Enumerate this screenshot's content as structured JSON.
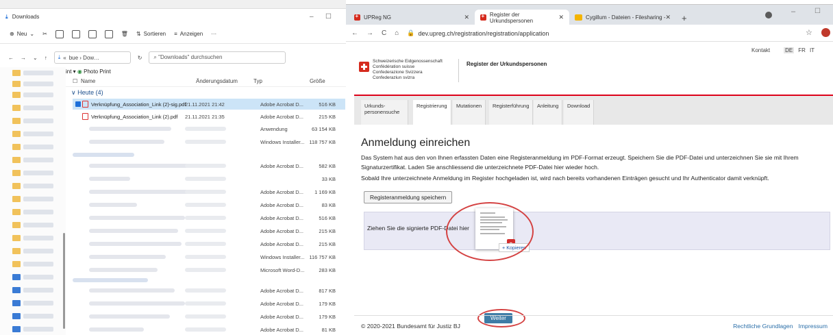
{
  "explorer": {
    "window_title": "Downloads",
    "command_bar": {
      "new_label": "Neu",
      "sort_label": "Sortieren",
      "view_label": "Anzeigen",
      "more_label": "···"
    },
    "nav": {
      "address_prefix": "«",
      "address": "bue › Dow…",
      "search_placeholder": "\"Downloads\" durchsuchen"
    },
    "crumb_fragment_prefix": "int ▾",
    "crumb_fragment": "Photo Print",
    "columns": {
      "name": "Name",
      "date": "Änderungsdatum",
      "type": "Typ",
      "size": "Größe"
    },
    "group_today": "∨ Heute (4)",
    "files": [
      {
        "name": "Verknüpfung_Association_Link (2)-sig.pdf",
        "date": "21.11.2021 21:42",
        "type": "Adobe Acrobat D...",
        "size": "516 KB"
      },
      {
        "name": "Verknüpfung_Association_Link (2).pdf",
        "date": "21.11.2021 21:35",
        "type": "Adobe Acrobat D...",
        "size": "215 KB"
      }
    ],
    "other_rows": [
      {
        "type": "Anwendung",
        "size": "63 154 KB"
      },
      {
        "type": "Windows Installer...",
        "size": "118 757 KB"
      },
      {
        "type": "Adobe Acrobat D...",
        "size": "582 KB"
      },
      {
        "type": "",
        "size": "33 KB"
      },
      {
        "type": "Adobe Acrobat D...",
        "size": "1 169 KB"
      },
      {
        "type": "Adobe Acrobat D...",
        "size": "83 KB"
      },
      {
        "type": "Adobe Acrobat D...",
        "size": "516 KB"
      },
      {
        "type": "Adobe Acrobat D...",
        "size": "215 KB"
      },
      {
        "type": "Adobe Acrobat D...",
        "size": "215 KB"
      },
      {
        "type": "Windows Installer...",
        "size": "116 757 KB"
      },
      {
        "type": "Microsoft Word-D...",
        "size": "283 KB"
      },
      {
        "type": "Adobe Acrobat D...",
        "size": "817 KB"
      },
      {
        "type": "Adobe Acrobat D...",
        "size": "179 KB"
      },
      {
        "type": "Adobe Acrobat D...",
        "size": "179 KB"
      },
      {
        "type": "Adobe Acrobat D...",
        "size": "81 KB"
      }
    ]
  },
  "browser": {
    "tabs": [
      {
        "label": "UPReg NG"
      },
      {
        "label": "Register der Urkundspersonen"
      },
      {
        "label": "Cygillum - Dateien - Filesharing -"
      }
    ],
    "new_tab": "+",
    "url": "dev.upreg.ch/registration/registration/application"
  },
  "site": {
    "agency_lines": [
      "Schweizerische Eidgenossenschaft",
      "Confédération suisse",
      "Confederazione Svizzera",
      "Confederaziun svizra"
    ],
    "title": "Register der Urkundspersonen",
    "contact": "Kontakt",
    "languages": [
      "DE",
      "FR",
      "IT"
    ],
    "nav_tabs": [
      "Urkunds-\npersonensuche",
      "Registrierung",
      "Mutationen",
      "Registerführung",
      "Anleitung",
      "Download"
    ],
    "page_title": "Anmeldung einreichen",
    "para1": "Das System hat aus den von Ihnen erfassten Daten eine Registeranmeldung im PDF-Format erzeugt. Speichern Sie die PDF-Datei und unterzeichnen Sie sie mit Ihrem Signaturzertifikat. Laden Sie anschliessend die unterzeichnete PDF-Datei hier wieder hoch.",
    "para2": "Sobald Ihre unterzeichnete Anmeldung im Register hochgeladen ist, wird nach bereits vorhandenen Einträgen gesucht und Ihr Authenticator damit verknüpft.",
    "save_button": "Registeranmeldung speichern",
    "dropzone_text": "Ziehen Sie die signierte PDF-Datei hier",
    "copy_tooltip": "+ Kopieren",
    "next_button": "Weiter",
    "copyright": "© 2020-2021 Bundesamt für Justiz BJ",
    "footer_links": [
      "Rechtliche Grundlagen",
      "Impressum"
    ]
  },
  "colors": {
    "swiss_red": "#d52b1e",
    "rule_red": "#dc0018",
    "button_blue": "#3e7ca6",
    "annotation_red": "#d44242",
    "dropzone": "#e9e9f5"
  }
}
